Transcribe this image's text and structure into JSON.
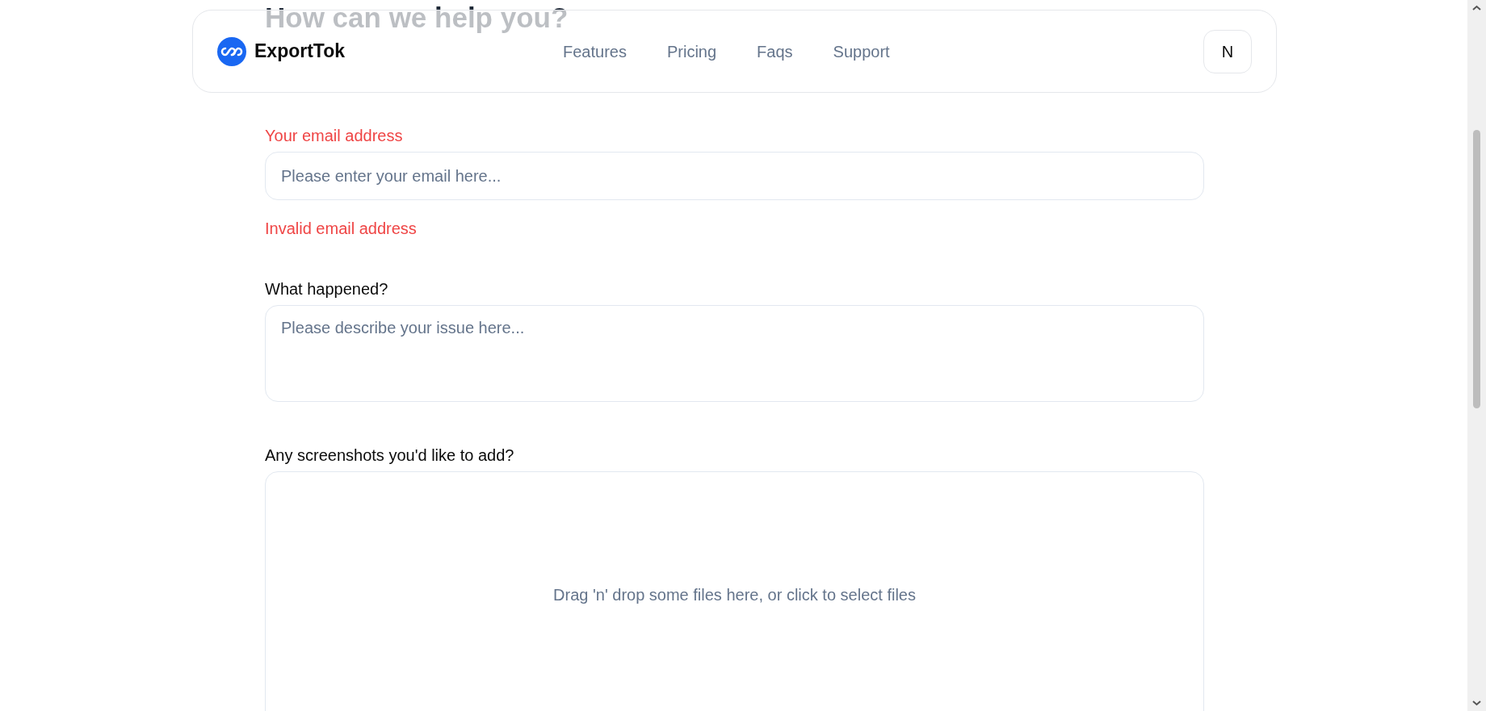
{
  "header": {
    "logo_text": "ExportTok",
    "nav": [
      {
        "label": "Features"
      },
      {
        "label": "Pricing"
      },
      {
        "label": "Faqs"
      },
      {
        "label": "Support"
      }
    ],
    "avatar": "N"
  },
  "heading": "How can we help you?",
  "email_field": {
    "label": "Your email address",
    "placeholder": "Please enter your email here...",
    "invalid": true,
    "error": "Invalid email address"
  },
  "issue_field": {
    "label": "What happened?",
    "placeholder": "Please describe your issue here...",
    "invalid": false
  },
  "upload": {
    "label": "Any screenshots you'd like to add?",
    "prompt": "Drag 'n' drop some files here, or click to select files"
  }
}
